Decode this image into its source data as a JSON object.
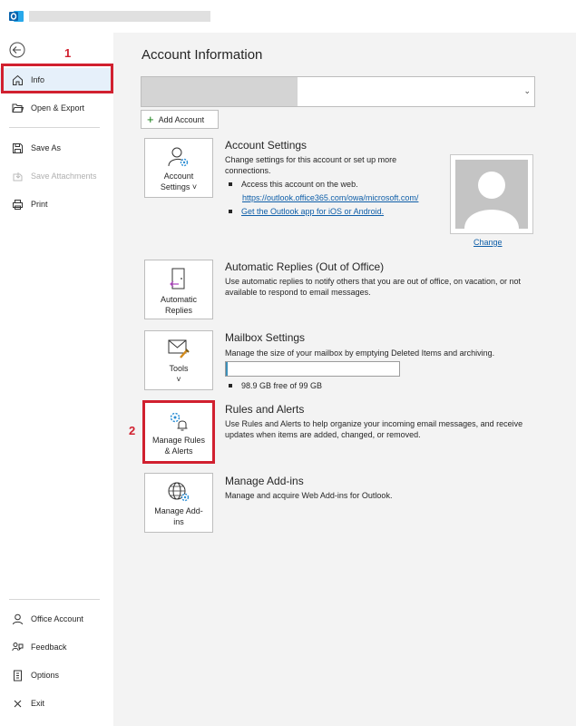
{
  "annotations": {
    "box1_label": "1",
    "box2_label": "2"
  },
  "sidebar": {
    "items": [
      {
        "label": "Info",
        "icon": "home-icon"
      },
      {
        "label": "Open & Export",
        "icon": "folder-open-icon"
      },
      {
        "label": "Save As",
        "icon": "save-icon"
      },
      {
        "label": "Save Attachments",
        "icon": "attachment-icon"
      },
      {
        "label": "Print",
        "icon": "printer-icon"
      }
    ],
    "bottom_items": [
      {
        "label": "Office Account",
        "icon": "person-icon"
      },
      {
        "label": "Feedback",
        "icon": "feedback-icon"
      },
      {
        "label": "Options",
        "icon": "options-icon"
      },
      {
        "label": "Exit",
        "icon": "close-icon"
      }
    ]
  },
  "main": {
    "title": "Account Information",
    "add_account_label": "Add Account",
    "account_settings": {
      "tile_label_1": "Account",
      "tile_label_2": "Settings ˅",
      "title": "Account Settings",
      "description": "Change settings for this account or set up more connections.",
      "bullet1": "Access this account on the web.",
      "link1": "https://outlook.office365.com/owa/microsoft.com/",
      "link2": "Get the Outlook app for iOS or Android.",
      "change_label": "Change"
    },
    "auto_replies": {
      "tile_label_1": "Automatic",
      "tile_label_2": "Replies",
      "title": "Automatic Replies (Out of Office)",
      "description": "Use automatic replies to notify others that you are out of office, on vacation, or not available to respond to email messages."
    },
    "mailbox": {
      "tile_label_1": "Tools",
      "tile_label_2": "˅",
      "title": "Mailbox Settings",
      "description": "Manage the size of your mailbox by emptying Deleted Items and archiving.",
      "quota_text": "98.9 GB free of 99 GB",
      "quota_used_fraction": 0.011
    },
    "rules": {
      "tile_label_1": "Manage Rules",
      "tile_label_2": "& Alerts",
      "title": "Rules and Alerts",
      "description": "Use Rules and Alerts to help organize your incoming email messages, and receive updates when items are added, changed, or removed."
    },
    "addins": {
      "tile_label_1": "Manage Add-",
      "tile_label_2": "ins",
      "title": "Manage Add-ins",
      "description": "Manage and acquire Web Add-ins for Outlook."
    }
  },
  "colors": {
    "accent": "#0e5ea8",
    "annotation": "#d1202f",
    "quota_fill": "#3d8fb8"
  }
}
